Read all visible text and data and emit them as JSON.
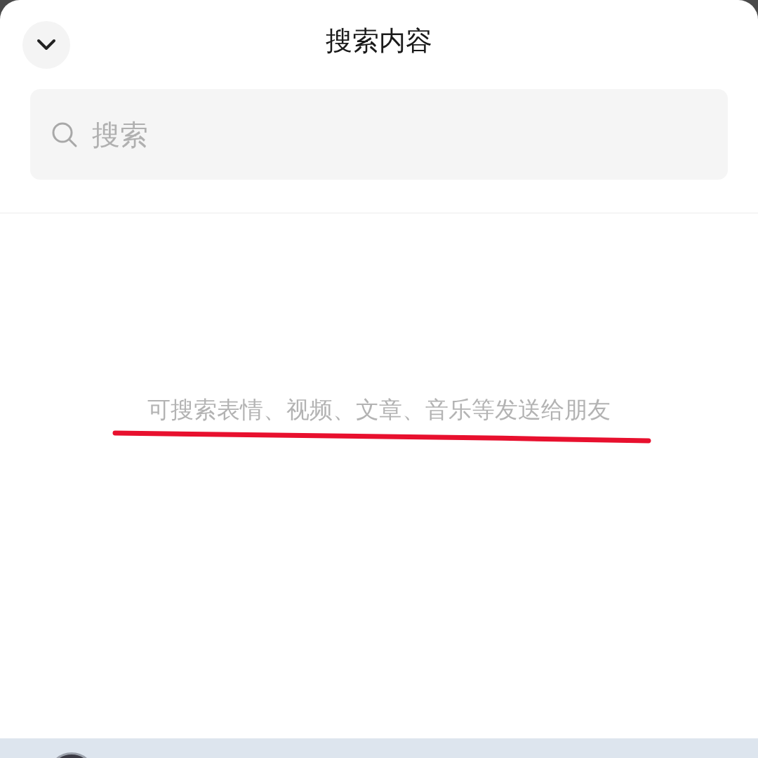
{
  "header": {
    "title": "搜索内容"
  },
  "search": {
    "placeholder": "搜索"
  },
  "empty_state": {
    "hint": "可搜索表情、视频、文章、音乐等发送给朋友",
    "annotation": {
      "kind": "underline"
    }
  }
}
